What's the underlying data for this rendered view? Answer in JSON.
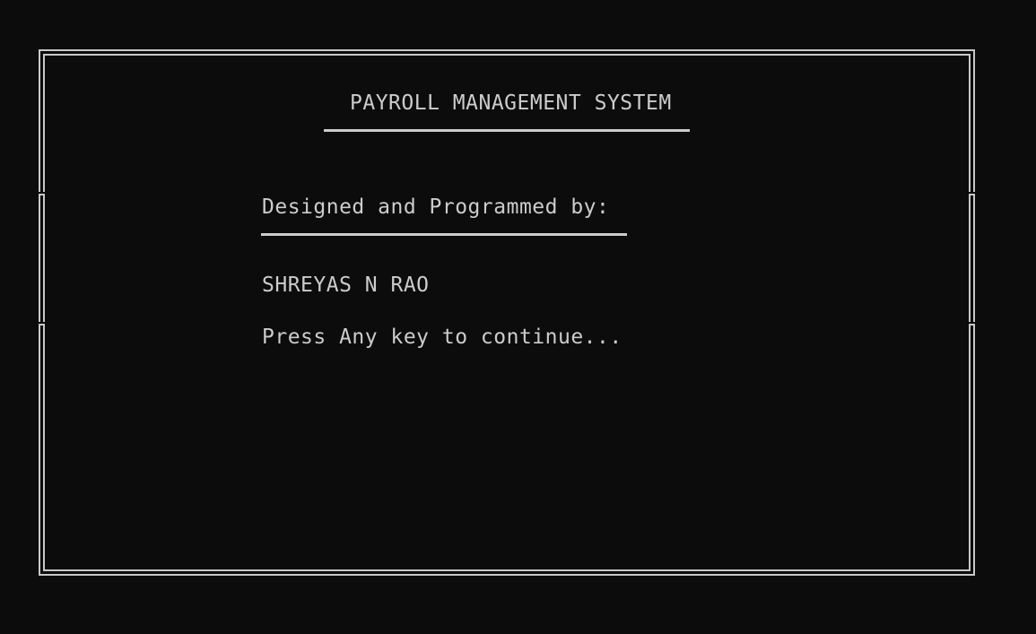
{
  "colors": {
    "background": "#0c0c0c",
    "foreground": "#cccccc"
  },
  "splash": {
    "title": "PAYROLL MANAGEMENT SYSTEM",
    "credit_label": "Designed and Programmed by:",
    "author": "SHREYAS N RAO",
    "prompt": "Press Any key to continue..."
  }
}
